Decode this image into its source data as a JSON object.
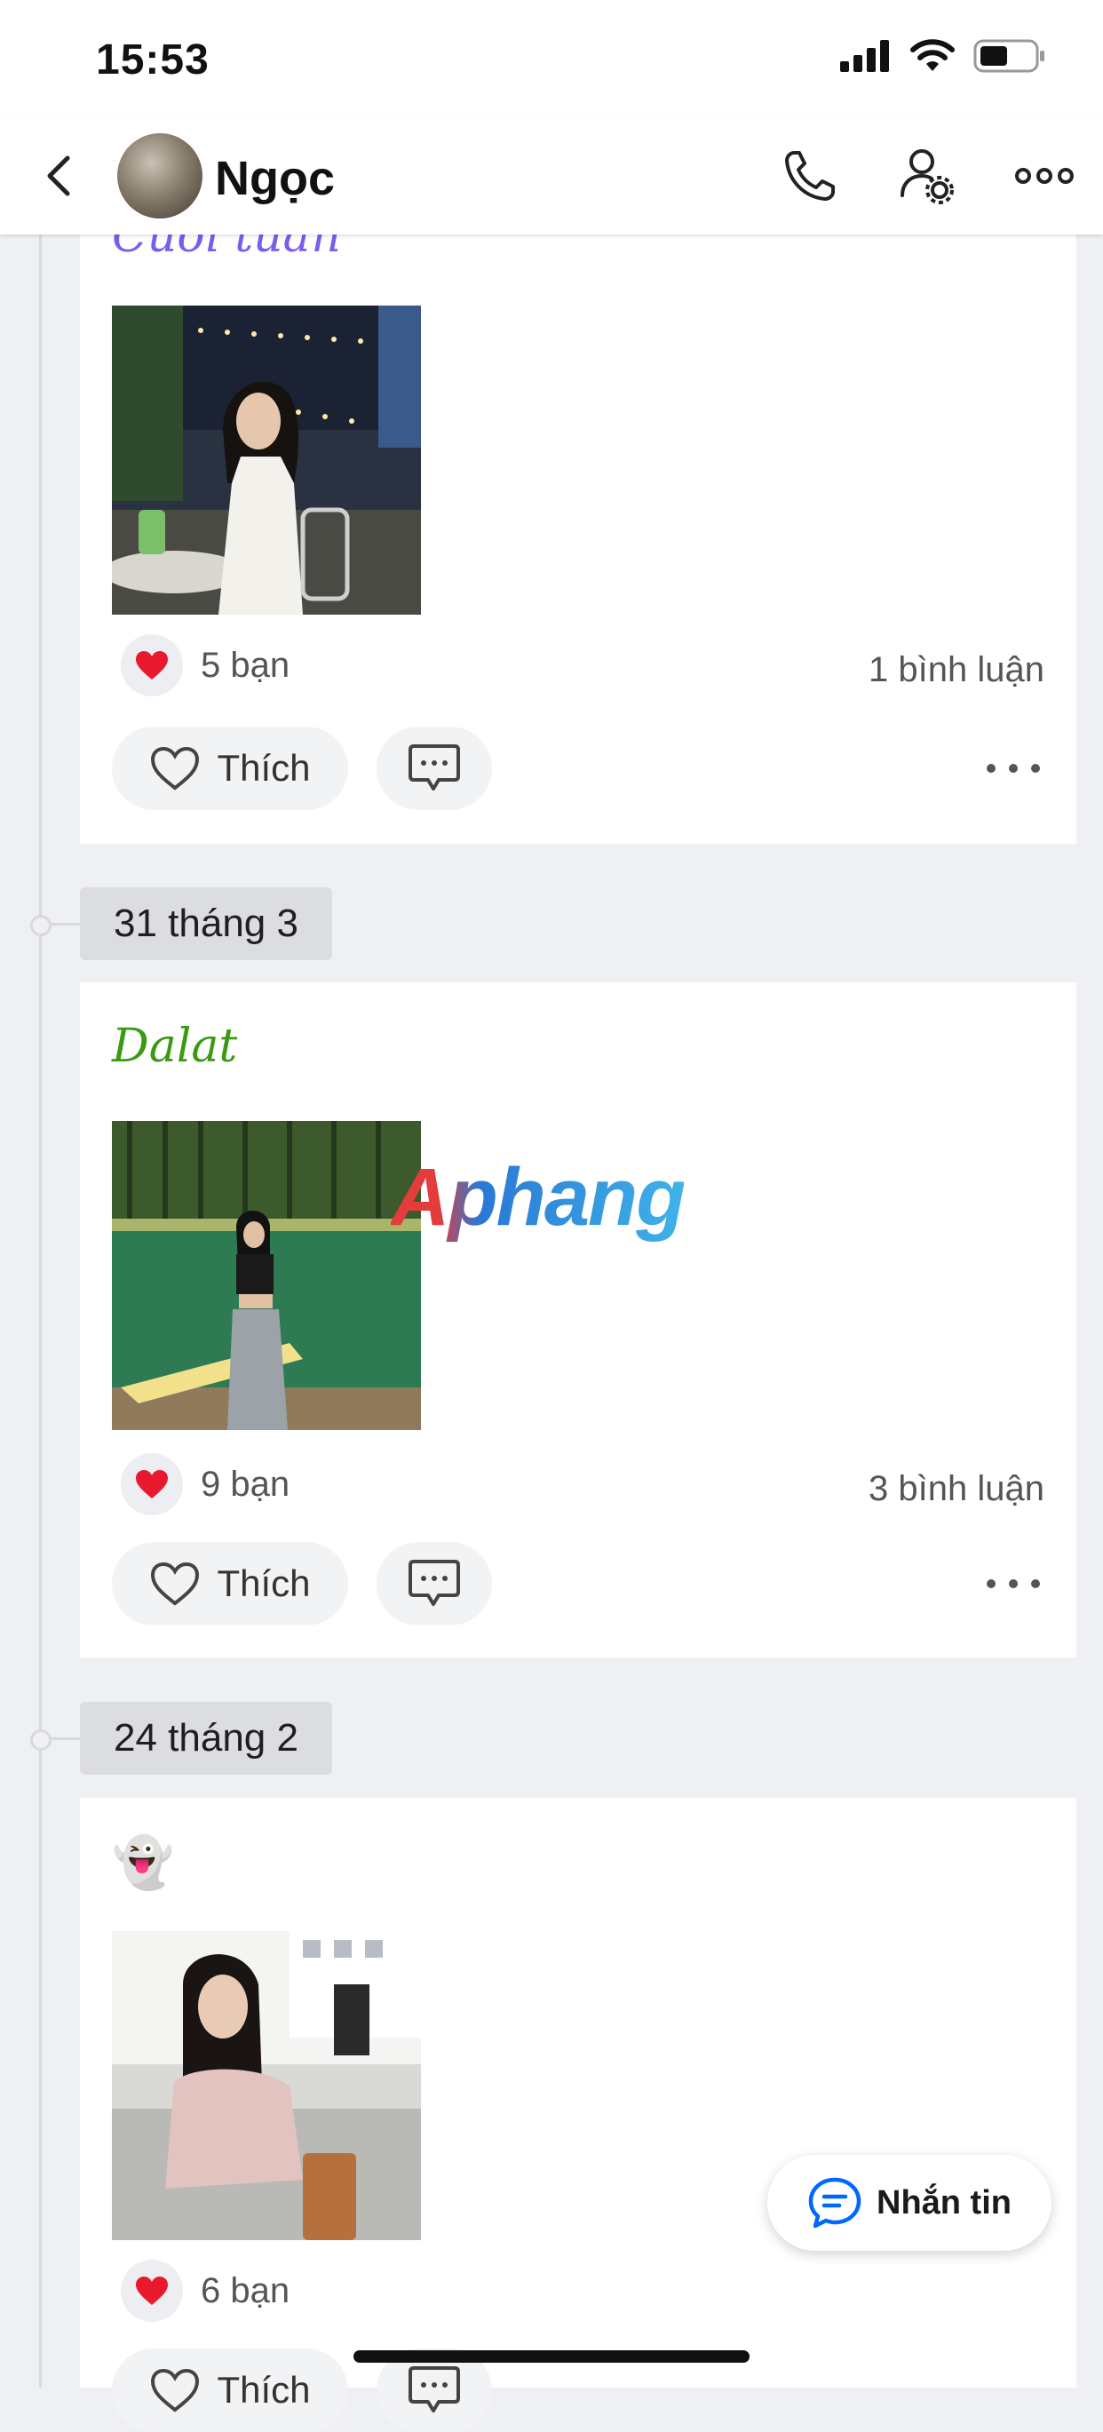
{
  "status": {
    "time": "15:53"
  },
  "header": {
    "name": "Ngọc"
  },
  "posts": [
    {
      "caption": "Cuối tuần",
      "caption_color": "#7a5cf0",
      "likes": "5 bạn",
      "comments": "1 bình luận",
      "like_label": "Thích"
    },
    {
      "date": "31 tháng 3",
      "caption": "Dalat",
      "caption_color": "#3a9a12",
      "likes": "9 bạn",
      "comments": "3 bình luận",
      "like_label": "Thích"
    },
    {
      "date": "24 tháng 2",
      "caption": "👻",
      "likes": "6 bạn",
      "like_label": "Thích"
    }
  ],
  "watermark": "Aphang",
  "message_button": {
    "label": "Nhắn tin"
  },
  "colors": {
    "accent": "#0068ff",
    "heart": "#e8192c"
  }
}
